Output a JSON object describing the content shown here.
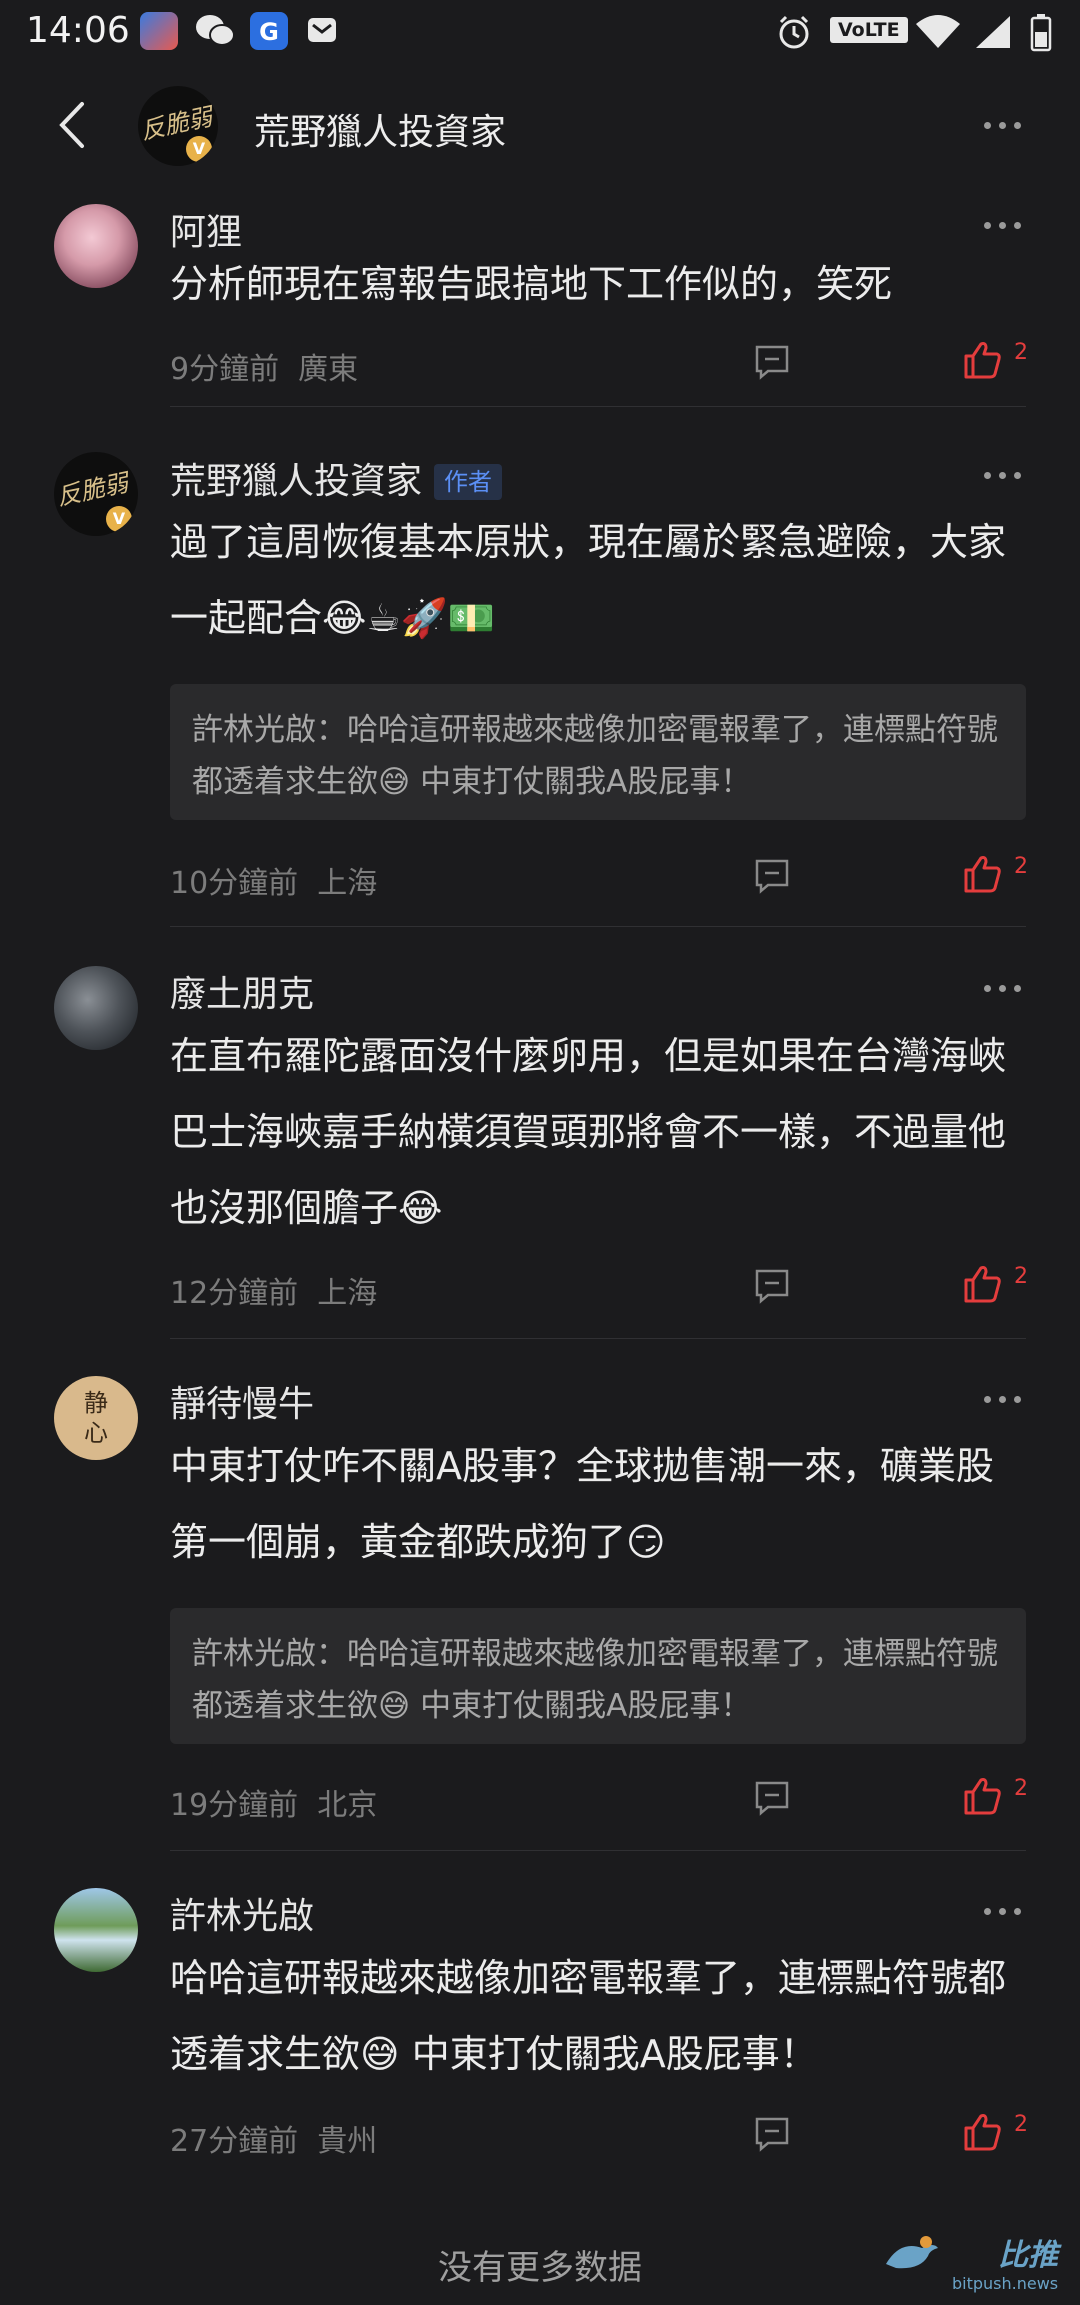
{
  "status_bar": {
    "time": "14:06",
    "volte": "VoLTE"
  },
  "header": {
    "title": "荒野獵人投資家",
    "avatar_text": "反脆弱",
    "verified": "V"
  },
  "comments": [
    {
      "name": "阿狸",
      "text": "分析師現在寫報告跟搞地下工作似的，笑死",
      "time": "9分鐘前",
      "location": "廣東",
      "likes": "2"
    },
    {
      "name": "荒野獵人投資家",
      "badge": "作者",
      "avatar_text": "反脆弱",
      "verified": "V",
      "text": "過了這周恢復基本原狀，現在屬於緊急避險，大家一起配合",
      "emojis": "😂☕🚀💵",
      "quote_prefix": "許林光啟：哈哈這研報越來越像加密電報羣了，連標點符號都透着求生欲",
      "quote_emoji": "😅",
      "quote_suffix": " 中東打仗關我A股屁事！",
      "time": "10分鐘前",
      "location": "上海",
      "likes": "2"
    },
    {
      "name": "廢土朋克",
      "text": "在直布羅陀露面沒什麼卵用，但是如果在台灣海峽巴士海峽嘉手納橫須賀頭那將會不一樣，不過量他也沒那個膽子",
      "emojis": "😂",
      "time": "12分鐘前",
      "location": "上海",
      "likes": "2"
    },
    {
      "name": "靜待慢牛",
      "avatar_text": "静心",
      "text": "中東打仗咋不關A股事？全球拋售潮一來，礦業股第一個崩，黃金都跌成狗了",
      "emojis": "😏",
      "quote_prefix": "許林光啟：哈哈這研報越來越像加密電報羣了，連標點符號都透着求生欲",
      "quote_emoji": "😅",
      "quote_suffix": " 中東打仗關我A股屁事！",
      "time": "19分鐘前",
      "location": "北京",
      "likes": "2"
    },
    {
      "name": "許林光啟",
      "text_prefix": "哈哈這研報越來越像加密電報羣了，連標點符號都透着求生欲",
      "text_emoji": "😅",
      "text_suffix": " 中東打仗關我A股屁事！",
      "time": "27分鐘前",
      "location": "貴州",
      "likes": "2"
    }
  ],
  "footer": {
    "no_more": "没有更多数据"
  },
  "watermark": {
    "brand": "比推",
    "site": "bitpush.news"
  },
  "colors": {
    "background": "#1b1b1d",
    "like": "#e43d3d",
    "author_badge": "#5b8ff5",
    "quote_bg": "#2a2a2c"
  }
}
